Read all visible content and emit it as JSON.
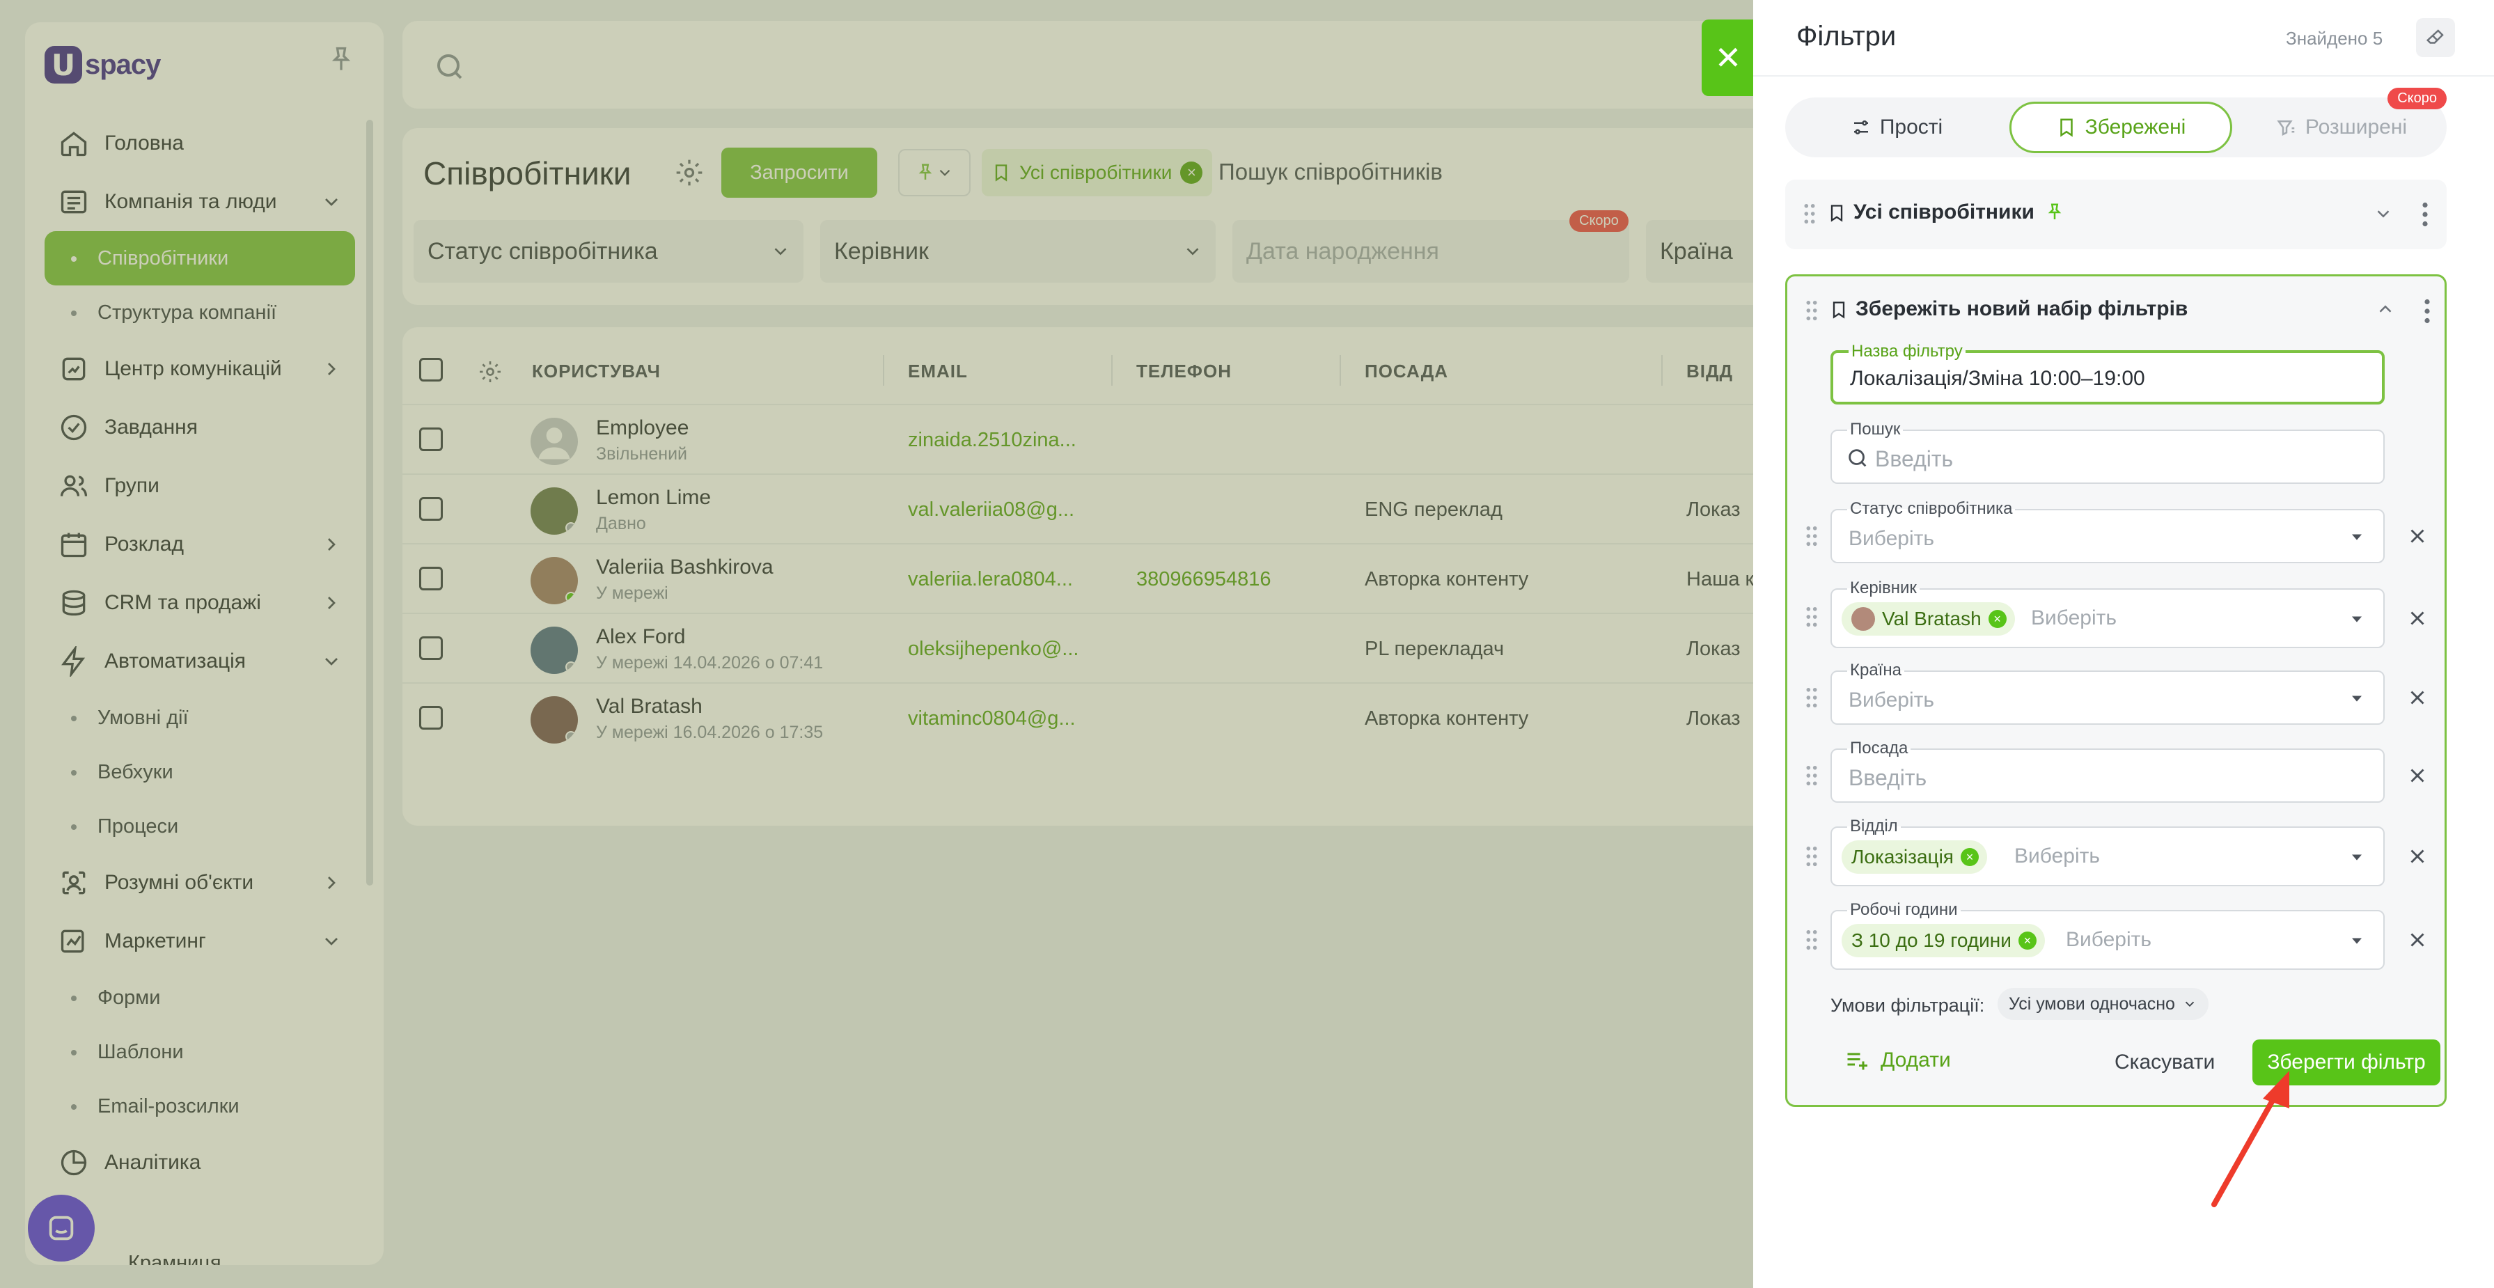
{
  "sidebar": {
    "logo_letter": "U",
    "logo_text": "spacy",
    "menu": [
      {
        "label": "Головна"
      },
      {
        "label": "Компанія та люди"
      },
      {
        "label": "Співробітники"
      },
      {
        "label": "Структура компанії"
      },
      {
        "label": "Центр комунікацій"
      },
      {
        "label": "Завдання"
      },
      {
        "label": "Групи"
      },
      {
        "label": "Розклад"
      },
      {
        "label": "CRM та продажі"
      },
      {
        "label": "Автоматизація"
      },
      {
        "label": "Умовні дії"
      },
      {
        "label": "Вебхуки"
      },
      {
        "label": "Процеси"
      },
      {
        "label": "Розумні об'єкти"
      },
      {
        "label": "Маркетинг"
      },
      {
        "label": "Форми"
      },
      {
        "label": "Шаблони"
      },
      {
        "label": "Email-розсилки"
      },
      {
        "label": "Аналітика"
      },
      {
        "label": "Крамниця"
      }
    ]
  },
  "main": {
    "title": "Співробітники",
    "invite_label": "Запросити",
    "chip_all": "Усі співробітники",
    "search_placeholder": "Пошук співробітників",
    "filters": [
      "Статус співробітника",
      "Керівник",
      "Дата народження",
      "Країна"
    ],
    "soon": "Скоро",
    "columns": [
      "КОРИСТУВАЧ",
      "EMAIL",
      "ТЕЛЕФОН",
      "ПОСАДА",
      "ВІДД"
    ],
    "rows": [
      {
        "name": "Employee",
        "sub": "Звільнений",
        "email": "zinaida.2510zina...",
        "phone": "",
        "position": "",
        "dept": ""
      },
      {
        "name": "Lemon Lime",
        "sub": "Давно",
        "email": "val.valeriia08@g...",
        "phone": "",
        "position": "ENG переклад",
        "dept": "Локаз"
      },
      {
        "name": "Valeriia Bashkirova",
        "sub": "У мережі",
        "email": "valeriia.lera0804...",
        "phone": "380966954816",
        "position": "Авторка контенту",
        "dept": "Наша к"
      },
      {
        "name": "Alex Ford",
        "sub": "У мережі 14.04.2026 о 07:41",
        "email": "oleksijhepenko@...",
        "phone": "",
        "position": "PL перекладач",
        "dept": "Локаз"
      },
      {
        "name": "Val Bratash",
        "sub": "У мережі 16.04.2026 о 17:35",
        "email": "vitaminc0804@g...",
        "phone": "",
        "position": "Авторка контенту",
        "dept": "Локаз"
      }
    ]
  },
  "panel": {
    "title": "Фільтри",
    "found": "Знайдено 5",
    "tabs": [
      {
        "label": "Прості"
      },
      {
        "label": "Збережені"
      },
      {
        "label": "Розширені"
      }
    ],
    "soon": "Скоро",
    "saved_set_name": "Усі співробітники",
    "new_set_title": "Збережіть новий набір фільтрів",
    "fields": {
      "name_label": "Назва фільтру",
      "name_value": "Локалізація/Зміна 10:00–19:00",
      "search_label": "Пошук",
      "search_placeholder": "Введіть",
      "status_label": "Статус співробітника",
      "status_placeholder": "Виберіть",
      "manager_label": "Керівник",
      "manager_chip": "Val Bratash",
      "manager_placeholder": "Виберіть",
      "country_label": "Країна",
      "country_placeholder": "Виберіть",
      "position_label": "Посада",
      "position_placeholder": "Введіть",
      "dept_label": "Відділ",
      "dept_chip": "Локазізація",
      "dept_placeholder": "Виберіть",
      "hours_label": "Робочі години",
      "hours_chip": "З 10 до 19 години",
      "hours_placeholder": "Виберіть"
    },
    "conditions_label": "Умови фільтрації:",
    "conditions_value": "Усі умови одночасно",
    "add_label": "Додати",
    "cancel_label": "Скасувати",
    "save_label": "Зберегти фільтр"
  },
  "colors": {
    "accent": "#58c418",
    "accent_soft": "#7dc242",
    "soon_badge": "#ef4a4a",
    "brand": "#3f2a8c",
    "chat": "#5b3ee6",
    "arrow": "#ee3b2b"
  }
}
